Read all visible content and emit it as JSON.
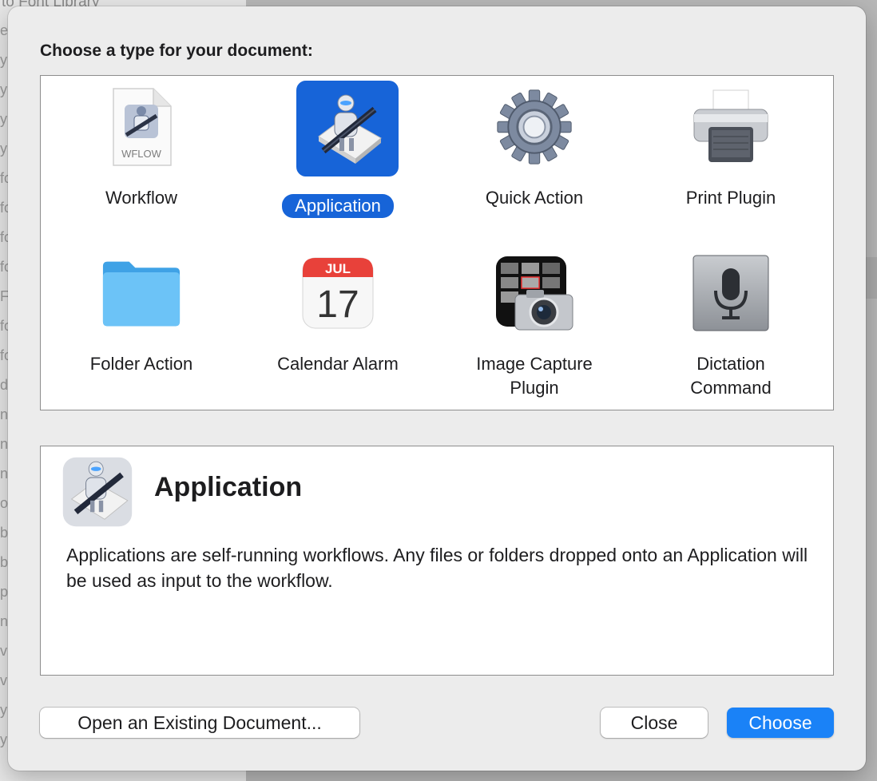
{
  "background": {
    "title_fragment": "to Font Library",
    "line_fragments": [
      "e",
      "y",
      "y",
      "y",
      "y",
      "fo",
      "fo",
      "fo",
      "fo",
      "F",
      "fo",
      "fo",
      "d",
      "n",
      "n",
      "n",
      "o",
      "b",
      "b",
      "p",
      "n",
      "v",
      "v",
      "y",
      "y"
    ]
  },
  "dialog": {
    "prompt": "Choose a type for your document:",
    "types": [
      {
        "label": "Workflow",
        "icon": "workflow-document-icon",
        "file_badge": "WFLOW",
        "selected": false
      },
      {
        "label": "Application",
        "icon": "automator-robot-icon",
        "selected": true
      },
      {
        "label": "Quick Action",
        "icon": "gear-icon",
        "selected": false
      },
      {
        "label": "Print Plugin",
        "icon": "printer-icon",
        "selected": false
      },
      {
        "label": "Folder Action",
        "icon": "folder-icon",
        "selected": false
      },
      {
        "label": "Calendar Alarm",
        "icon": "calendar-icon",
        "calendar_month": "JUL",
        "calendar_day": "17",
        "selected": false
      },
      {
        "label": "Image Capture Plugin",
        "label_line1": "Image Capture",
        "label_line2": "Plugin",
        "icon": "image-capture-camera-icon",
        "selected": false
      },
      {
        "label": "Dictation Command",
        "label_line1": "Dictation",
        "label_line2": "Command",
        "icon": "microphone-icon",
        "selected": false
      }
    ],
    "description": {
      "title": "Application",
      "text": "Applications are self-running workflows. Any files or folders dropped onto an Application will be used as input to the workflow."
    },
    "buttons": {
      "open_existing": "Open an Existing Document...",
      "close": "Close",
      "choose": "Choose"
    },
    "colors": {
      "accent": "#1a82f7",
      "selection": "#1764d8",
      "calendar_red": "#e8413a",
      "folder_blue": "#5ab8f2"
    }
  }
}
